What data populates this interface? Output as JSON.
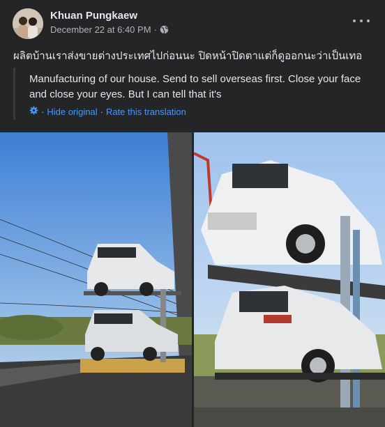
{
  "post": {
    "author": "Khuan Pungkaew",
    "date": "December 22 at 6:40 PM",
    "date_separator": "·",
    "privacy_icon": "globe-icon",
    "more_icon": "more-options-icon",
    "text": "ผลิตบ้านเราส่งขายต่างประเทศไปก่อนนะ ปิดหน้าปิดตาแต่ก็ดูออกนะว่าเป็นเทอ",
    "translation": {
      "text": "Manufacturing of our house. Send to sell overseas first. Close your face and close your eyes. But I can tell that it's",
      "settings_icon": "gear-icon",
      "sep": "·",
      "hide_original": "Hide original",
      "rate": "Rate this translation"
    }
  },
  "colors": {
    "background": "#242526",
    "text": "#e4e6eb",
    "secondary_text": "#b0b3b8",
    "link": "#4599ff"
  },
  "photos": [
    {
      "alt": "car carrier truck on road"
    },
    {
      "alt": "car carrier truck close-up"
    }
  ]
}
